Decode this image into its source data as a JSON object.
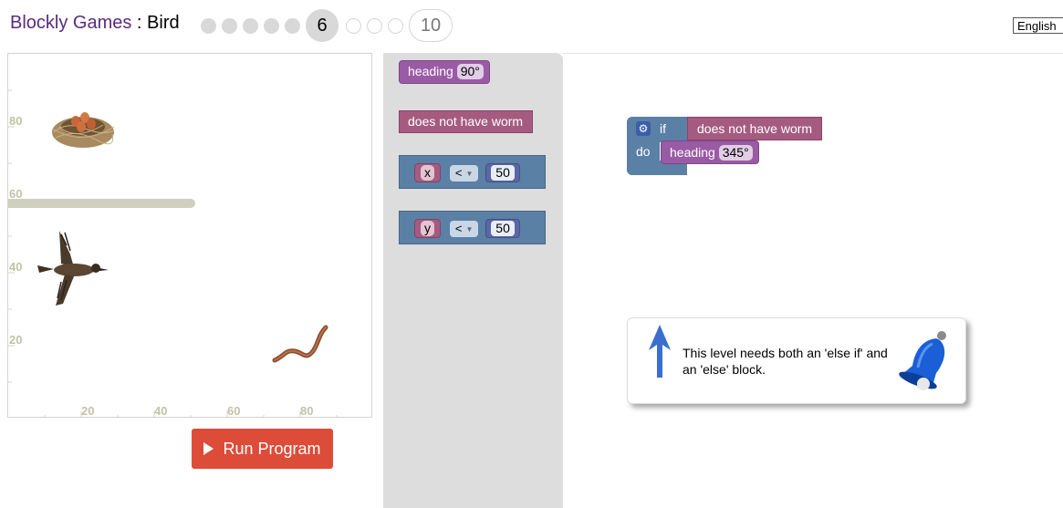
{
  "header": {
    "brand": "Blockly Games",
    "separator": " : ",
    "game": "Bird",
    "current_level": "6",
    "last_level": "10",
    "completed_levels": 5,
    "remaining_levels": 3,
    "language": "English"
  },
  "visualization": {
    "y_ticks": [
      "80",
      "60",
      "40",
      "20"
    ],
    "x_ticks": [
      "20",
      "40",
      "60",
      "80"
    ]
  },
  "run_button": {
    "label": "Run Program"
  },
  "flyout": {
    "heading_label": "heading",
    "heading_value": "90°",
    "no_worm_label": "does not have worm",
    "compare_x": {
      "var": "x",
      "op": "<",
      "value": "50"
    },
    "compare_y": {
      "var": "y",
      "op": "<",
      "value": "50"
    }
  },
  "workspace": {
    "if_label": "if",
    "do_label": "do",
    "condition": "does not have worm",
    "heading_label": "heading",
    "heading_value": "345°"
  },
  "hint": {
    "text": "This level needs both an 'else if' and an 'else' block."
  },
  "colors": {
    "brand": "#5b2a7f",
    "run_button": "#dd4b39",
    "motion_block": "#9a5ba5",
    "bird_block": "#a55b80",
    "logic_block": "#5b80a5"
  }
}
